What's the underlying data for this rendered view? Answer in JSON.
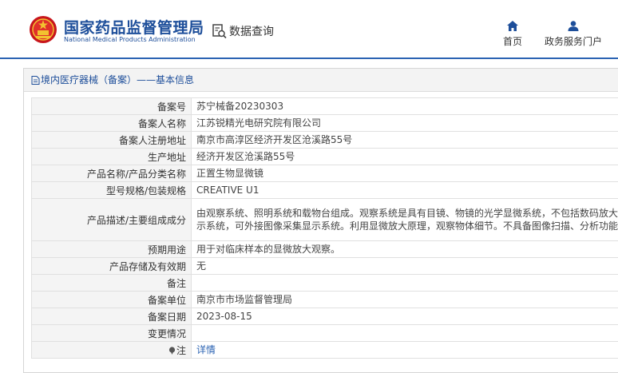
{
  "header": {
    "brand_cn": "国家药品监督管理局",
    "brand_en": "National Medical Products Administration",
    "data_query_label": "数据查询",
    "nav": [
      {
        "label": "首页",
        "icon": "home-icon"
      },
      {
        "label": "政务服务门户",
        "icon": "user-icon"
      }
    ],
    "accent_color": "#1d4e9a"
  },
  "breadcrumb": {
    "text": "境内医疗器械（备案）——基本信息"
  },
  "record": {
    "rows": [
      {
        "key": "备案号",
        "value": "苏宁械备20230303"
      },
      {
        "key": "备案人名称",
        "value": "江苏锐精光电研究院有限公司"
      },
      {
        "key": "备案人注册地址",
        "value": "南京市高淳区经济开发区沧溪路55号"
      },
      {
        "key": "生产地址",
        "value": "经济开发区沧溪路55号"
      },
      {
        "key": "产品名称/产品分类名称",
        "value": "正置生物显微镜"
      },
      {
        "key": "型号规格/包装规格",
        "value": "CREATIVE U1"
      },
      {
        "key": "产品描述/主要组成成分",
        "value": "由观察系统、照明系统和载物台组成。观察系统是具有目镜、物镜的光学显微系统，不包括数码放大显示系统，可外接图像采集显示系统。利用显微放大原理，观察物体细节。不具备图像扫描、分析功能。"
      },
      {
        "key": "预期用途",
        "value": "用于对临床样本的显微放大观察。"
      },
      {
        "key": "产品存储及有效期",
        "value": "无"
      },
      {
        "key": "备注",
        "value": ""
      },
      {
        "key": "备案单位",
        "value": "南京市市场监督管理局"
      },
      {
        "key": "备案日期",
        "value": "2023-08-15"
      },
      {
        "key": "变更情况",
        "value": ""
      },
      {
        "key": "注",
        "value": "详情",
        "icon": "info-icon"
      }
    ]
  }
}
